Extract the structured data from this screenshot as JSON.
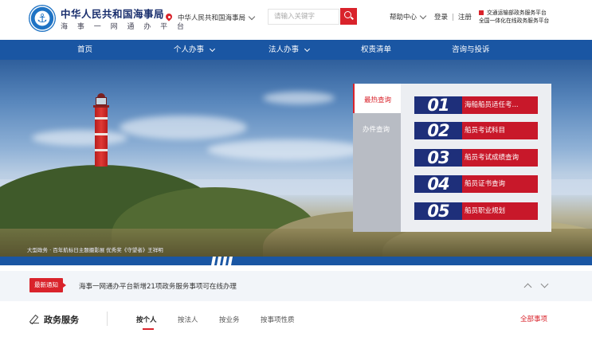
{
  "header": {
    "title": "中华人民共和国海事局",
    "subtitle": "海 事 一 网 通 办 平 台",
    "location": "中华人民共和国海事局",
    "search_placeholder": "请输入关键字",
    "help": "帮助中心",
    "login": "登录",
    "divider": "|",
    "register": "注册",
    "platform_line1": "交通运输部政务服务平台",
    "platform_line2": "全国一体化在线政务服务平台"
  },
  "nav": {
    "items": [
      {
        "label": "首页"
      },
      {
        "label": "个人办事"
      },
      {
        "label": "法人办事"
      },
      {
        "label": "权责清单"
      },
      {
        "label": "咨询与投诉"
      }
    ]
  },
  "banner": {
    "caption": "大型政务 · 百年航标日主题摄影展 优秀奖《守望者》王祥明"
  },
  "hot_panel": {
    "tab_active": "最热查询",
    "tab_inactive": "办件查询",
    "items": [
      {
        "num": "01",
        "label": "海船船员适任考..."
      },
      {
        "num": "02",
        "label": "船员考试科目"
      },
      {
        "num": "03",
        "label": "船员考试成绩查询"
      },
      {
        "num": "04",
        "label": "船员证书查询"
      },
      {
        "num": "05",
        "label": "船员职业规划"
      }
    ]
  },
  "notice": {
    "tag": "最新通知",
    "text": "海事一网通办平台新增21项政务服务事项可在线办理"
  },
  "services": {
    "title": "政务服务",
    "tabs": [
      "按个人",
      "按法人",
      "按业务",
      "按事项性质"
    ],
    "all": "全部事项"
  },
  "colors": {
    "nav_blue": "#1a56a3",
    "accent_red": "#d9232b",
    "num_navy": "#1e2f7a",
    "label_red": "#c8182a"
  }
}
